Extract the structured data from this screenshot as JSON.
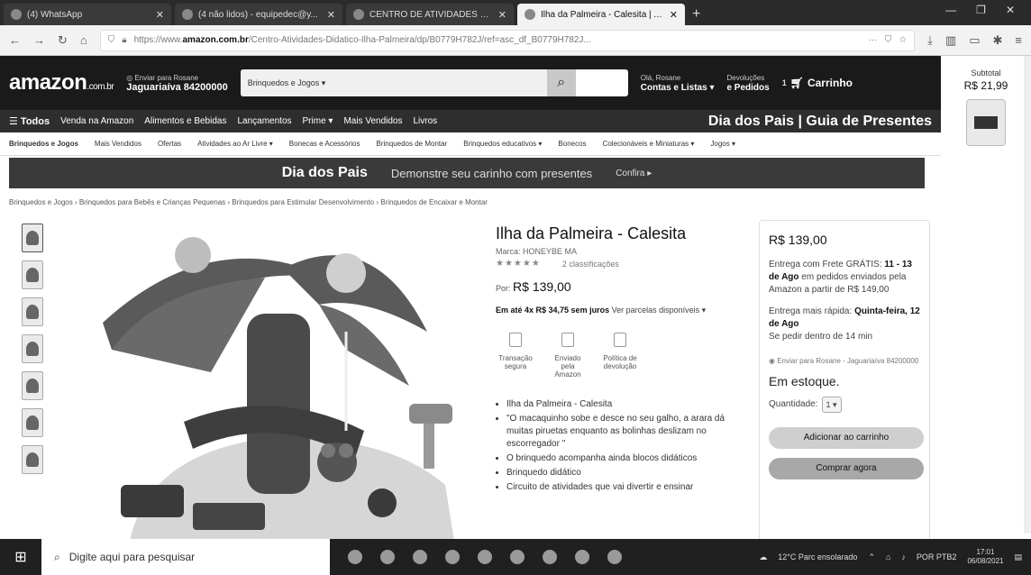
{
  "browser": {
    "tabs": [
      {
        "label": "(4) WhatsApp",
        "active": false
      },
      {
        "label": "(4 não lidos) - equipedec@y...",
        "active": false
      },
      {
        "label": "CENTRO DE ATIVIDADES DIDÁ...",
        "active": false
      },
      {
        "label": "Ilha da Palmeira - Calesita | Am...",
        "active": true
      }
    ],
    "url_prefix": "https://www.",
    "url_domain": "amazon.com.br",
    "url_path": "/Centro-Atividades-Didatico-Ilha-Palmeira/dp/B0779H782J/ref=asc_df_B0779H782J..."
  },
  "header": {
    "logo": "amazon",
    "logo_suffix": ".com.br",
    "deliver_label": "Enviar para Rosane",
    "deliver_location": "Jaguariaíva 84200000",
    "search_category": "Brinquedos e Jogos ▾",
    "account_top": "Olá, Rosane",
    "account_bottom": "Contas e Listas ▾",
    "returns_top": "Devoluções",
    "returns_bottom": "e Pedidos",
    "cart_count": "1",
    "cart_label": "Carrinho"
  },
  "subtotal": {
    "label": "Subtotal",
    "value": "R$ 21,99"
  },
  "nav": {
    "all": "Todos",
    "items": [
      "Venda na Amazon",
      "Alimentos e Bebidas",
      "Lançamentos",
      "Prime ▾",
      "Mais Vendidos",
      "Livros"
    ],
    "promo": "Dia dos Pais | Guia de Presentes"
  },
  "categories": [
    "Brinquedos e Jogos",
    "Mais Vendidos",
    "Ofertas",
    "Atividades ao Ar Livre ▾",
    "Bonecas e Acessórios",
    "Brinquedos de Montar",
    "Brinquedos educativos ▾",
    "Bonecos",
    "Colecionáveis e Miniaturas ▾",
    "Jogos ▾"
  ],
  "banner": {
    "title": "Dia dos Pais",
    "subtitle": "Demonstre seu carinho com presentes",
    "cta": "Confira ▸"
  },
  "breadcrumb": "Brinquedos e Jogos › Brinquedos para Bebês e Crianças Pequenas › Brinquedos para Estimular Desenvolvimento › Brinquedos de Encaixar e Montar",
  "product": {
    "title": "Ilha da Palmeira - Calesita",
    "brand": "Marca: HONEYBE MA",
    "stars": "★★★★★",
    "ratings": "2 classificações",
    "price_label": "Por:",
    "price": "R$ 139,00",
    "installments_bold": "Em até 4x R$ 34,75 sem juros",
    "installments_rest": "Ver parcelas disponíveis ▾",
    "features": [
      "Transação segura",
      "Enviado pela Amazon",
      "Política de devolução"
    ],
    "bullets": [
      "Ilha da Palmeira - Calesita",
      "\"O macaquinho sobe e desce no seu galho, a arara dá muitas piruetas enquanto as bolinhas deslizam no escorregador \"",
      "O brinquedo acompanha ainda blocos didáticos",
      "Brinquedo didático",
      "Circuito de atividades que vai divertir e ensinar"
    ]
  },
  "buybox": {
    "price": "R$ 139,00",
    "delivery_1": "Entrega com Frete GRÁTIS:",
    "delivery_dates": "11 - 13 de Ago",
    "delivery_2": "em pedidos enviados pela Amazon a partir de R$ 149,00",
    "fast_1": "Entrega mais rápida:",
    "fast_date": "Quinta-feira, 12 de Ago",
    "fast_2": "Se pedir dentro de 14 min",
    "address": "Enviar para Rosane - Jaguariaíva 84200000",
    "stock": "Em estoque.",
    "qty_label": "Quantidade:",
    "qty_value": "1",
    "add_button": "Adicionar ao carrinho",
    "buy_button": "Comprar agora"
  },
  "taskbar": {
    "search_placeholder": "Digite aqui para pesquisar",
    "weather": "12°C Parc ensolarado",
    "lang": "POR PTB2",
    "time": "17:01",
    "date": "06/08/2021"
  }
}
